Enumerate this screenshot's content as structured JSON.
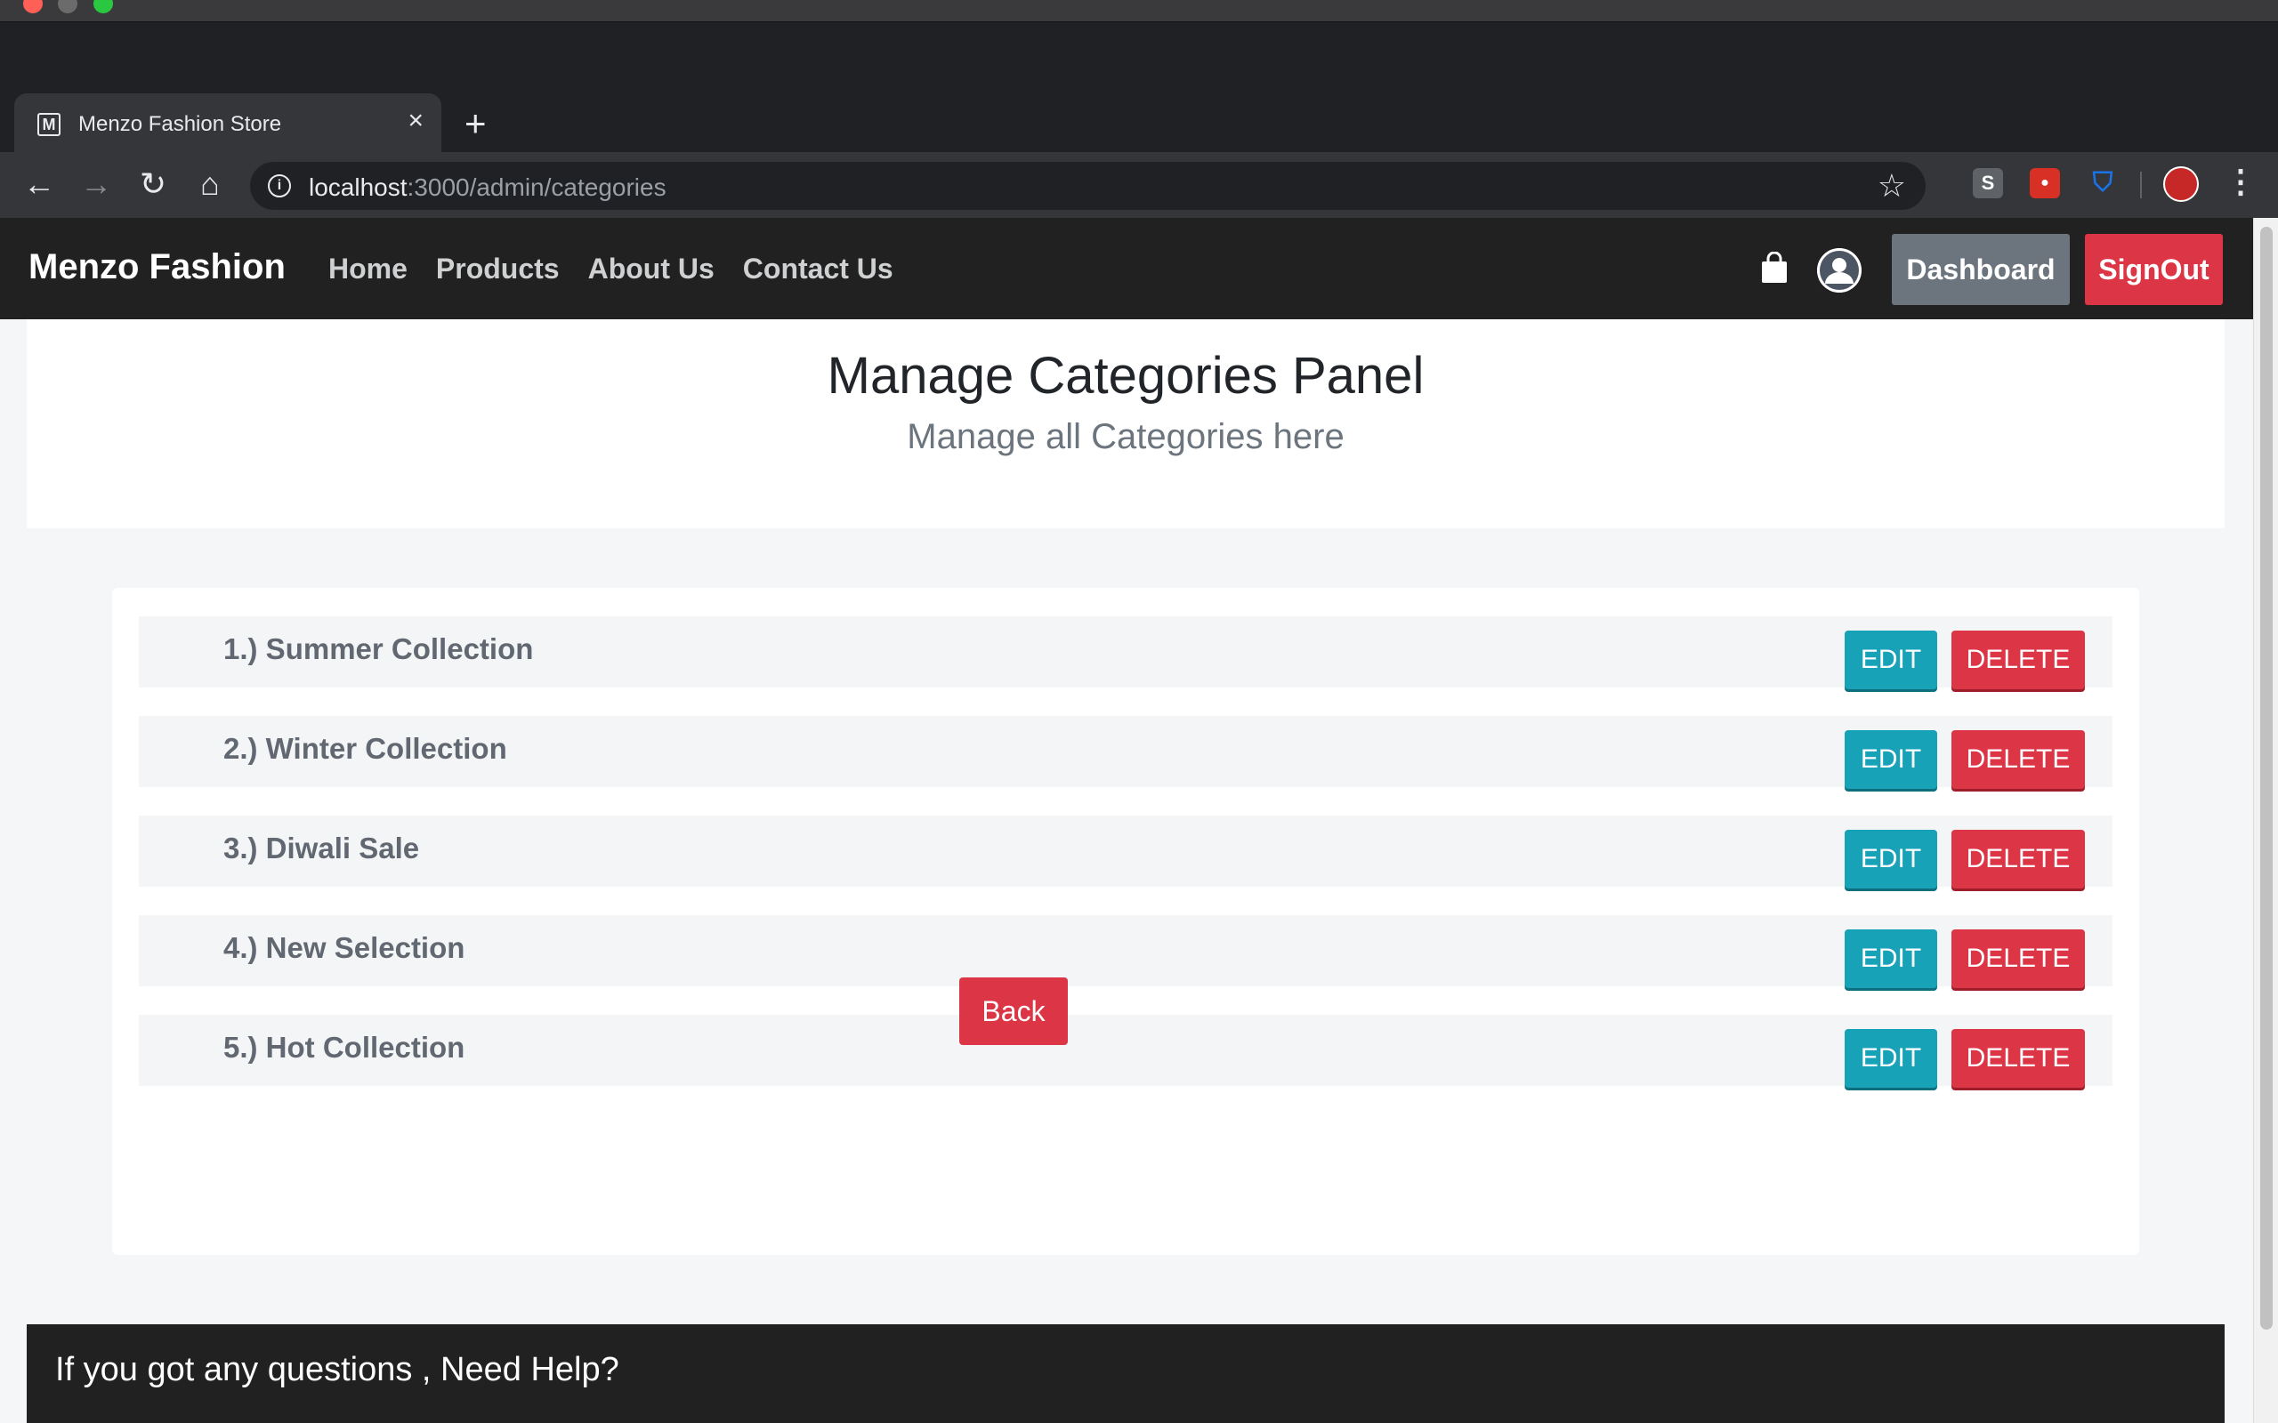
{
  "browser": {
    "tab_title": "Menzo Fashion Store",
    "tab_favicon": "M",
    "url_host": "localhost",
    "url_rest": ":3000/admin/categories"
  },
  "navbar": {
    "brand": "Menzo Fashion",
    "links": [
      "Home",
      "Products",
      "About Us",
      "Contact Us"
    ],
    "dashboard_label": "Dashboard",
    "signout_label": "SignOut"
  },
  "header": {
    "title": "Manage Categories Panel",
    "subtitle": "Manage all Categories here"
  },
  "categories": [
    {
      "label": "1.) Summer Collection",
      "edit": "EDIT",
      "delete": "DELETE"
    },
    {
      "label": "2.) Winter Collection",
      "edit": "EDIT",
      "delete": "DELETE"
    },
    {
      "label": "3.) Diwali Sale",
      "edit": "EDIT",
      "delete": "DELETE"
    },
    {
      "label": "4.) New Selection",
      "edit": "EDIT",
      "delete": "DELETE"
    },
    {
      "label": "5.) Hot Collection",
      "edit": "EDIT",
      "delete": "DELETE"
    }
  ],
  "back_label": "Back",
  "footer": {
    "text": "If you got any questions , Need Help?"
  },
  "colors": {
    "navbar": "#212121",
    "edit": "#17a2b8",
    "danger": "#dc3545",
    "secondary": "#6c757d"
  }
}
